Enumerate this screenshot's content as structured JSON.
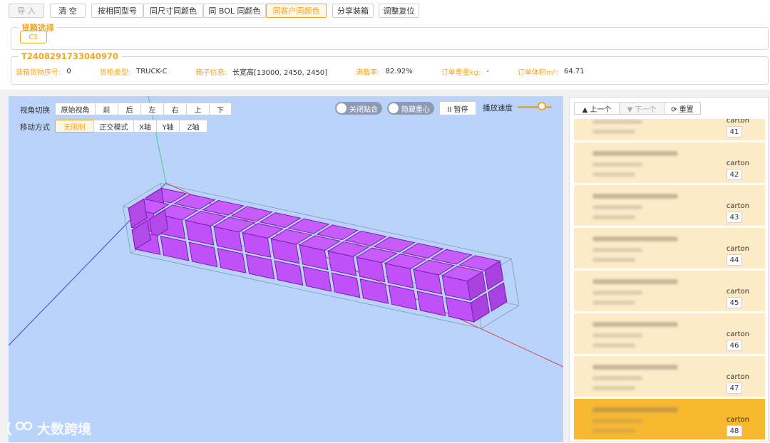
{
  "toolbar": {
    "import": "导 入",
    "clear": "清 空",
    "same_model": "按相同型号",
    "same_size_color": "同尺寸同颜色",
    "same_bol_color": "同 BOL 同颜色",
    "same_customer_color": "同客户同颜色",
    "share": "分享装箱",
    "reset_adjust": "调整复位"
  },
  "container_select": {
    "legend": "货箱选择",
    "tag": "C1"
  },
  "order": {
    "id": "T2408291733040970",
    "seq_label": "装箱货物序号:",
    "seq_value": "0",
    "type_label": "货柜类型:",
    "type_value": "TRUCK-C",
    "box_label": "箱子信息:",
    "box_value": "长宽高[13000, 2450, 2450]",
    "load_label": "满载率:",
    "load_value": "82.92%",
    "weight_label": "订单重量kg:",
    "weight_value": "-",
    "volume_label": "订单体积m³:",
    "volume_value": "64.71"
  },
  "viewport": {
    "view_label": "视角切换",
    "views": [
      "原始视角",
      "前",
      "后",
      "左",
      "右",
      "上",
      "下"
    ],
    "move_label": "移动方式",
    "moves": [
      "无限制",
      "正交模式",
      "X轴",
      "Y轴",
      "Z轴"
    ],
    "toggle_snap": "关闭贴合",
    "toggle_gravity": "隐藏重心",
    "pause": "II  暂停",
    "speed_label": "播放速度",
    "speed_level": 0.7,
    "colors": {
      "box": "#c050f8",
      "box_edge": "#7a1fb0",
      "background": "#b9d3fb",
      "accent": "#f3a51f"
    }
  },
  "watermark": {
    "text": "大数跨境"
  },
  "right_panel": {
    "prev": "▲ 上一个",
    "next": "▼ 下一个",
    "reset": "⟳ 重置",
    "items": [
      {
        "type": "carton",
        "num": "41"
      },
      {
        "type": "carton",
        "num": "42"
      },
      {
        "type": "carton",
        "num": "43"
      },
      {
        "type": "carton",
        "num": "44"
      },
      {
        "type": "carton",
        "num": "45"
      },
      {
        "type": "carton",
        "num": "46"
      },
      {
        "type": "carton",
        "num": "47"
      },
      {
        "type": "carton",
        "num": "48"
      }
    ]
  }
}
